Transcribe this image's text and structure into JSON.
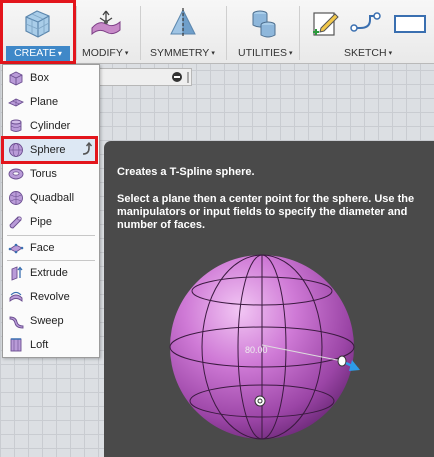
{
  "toolbar": {
    "create_label": "CREATE",
    "modify_label": "MODIFY",
    "symmetry_label": "SYMMETRY",
    "utilities_label": "UTILITIES",
    "sketch_label": "SKETCH",
    "caret": "▾"
  },
  "create_menu": {
    "items": [
      {
        "label": "Box",
        "icon": "box-icon"
      },
      {
        "label": "Plane",
        "icon": "plane-icon"
      },
      {
        "label": "Cylinder",
        "icon": "cylinder-icon"
      },
      {
        "label": "Sphere",
        "icon": "sphere-icon",
        "highlighted": true
      },
      {
        "label": "Torus",
        "icon": "torus-icon"
      },
      {
        "label": "Quadball",
        "icon": "quadball-icon"
      },
      {
        "label": "Pipe",
        "icon": "pipe-icon"
      },
      {
        "label": "Face",
        "icon": "face-icon"
      },
      {
        "label": "Extrude",
        "icon": "extrude-icon"
      },
      {
        "label": "Revolve",
        "icon": "revolve-icon"
      },
      {
        "label": "Sweep",
        "icon": "sweep-icon"
      },
      {
        "label": "Loft",
        "icon": "loft-icon"
      }
    ]
  },
  "tooltip": {
    "title": "Creates a T-Spline sphere.",
    "body": "Select a plane then a center point for the sphere. Use the manipulators or input fields to specify the diameter and number of faces.",
    "diameter_value": "80.00"
  },
  "colors": {
    "accent": "#3f88c8",
    "highlight_box": "#e3151c",
    "tooltip_bg": "#4a4a4a",
    "sphere": "#c76ad0"
  }
}
